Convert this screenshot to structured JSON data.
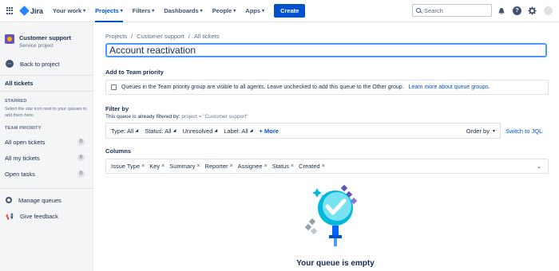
{
  "topnav": {
    "logo": "Jira",
    "items": [
      "Your work",
      "Projects",
      "Filters",
      "Dashboards",
      "People",
      "Apps"
    ],
    "active": "Projects",
    "create_label": "Create",
    "search_placeholder": "Search",
    "accent": "#0052cc"
  },
  "sidebar": {
    "project_name": "Customer support",
    "project_type": "Service project",
    "back_label": "Back to project",
    "all_tickets": "All tickets",
    "starred_title": "STARRED",
    "starred_note": "Select the star icon next to your queues to add them here.",
    "team_priority_title": "TEAM PRIORITY",
    "queues": [
      {
        "label": "All open tickets",
        "count": "0"
      },
      {
        "label": "All my tickets",
        "count": "0"
      },
      {
        "label": "Open tasks",
        "count": "0"
      }
    ],
    "manage_queues": "Manage queues",
    "give_feedback": "Give feedback"
  },
  "main": {
    "breadcrumbs": [
      "Projects",
      "/",
      "Customer support",
      "/",
      "All tickets"
    ],
    "title_value": "Account reactivation",
    "team_priority_label": "Add to Team priority",
    "team_priority_text": "Queues in the Team priority group are visible to all agents. Leave unchecked to add this queue to the Other group.",
    "team_priority_link": "Learn more about queue groups.",
    "filter_label": "Filter by",
    "filter_note": "This queue is already filtered by:",
    "filter_query": "project = \"Customer support\"",
    "filters": [
      "Type: All",
      "Status: All",
      "Unresolved",
      "Label: All"
    ],
    "more_label": "+ More",
    "order_by": "Order by",
    "switch_jql": "Switch to JQL",
    "columns_label": "Columns",
    "columns": [
      "Issue Type",
      "Key",
      "Summary",
      "Reporter",
      "Assignee",
      "Status",
      "Created"
    ],
    "empty_text": "Your queue is empty"
  }
}
